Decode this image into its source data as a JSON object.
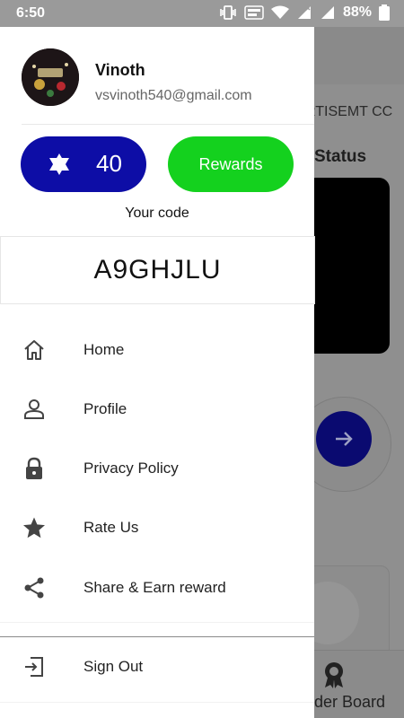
{
  "status_bar": {
    "time": "6:50",
    "battery": "88%"
  },
  "background": {
    "banner_text": "RTISEMT CC",
    "status_heading": "Status",
    "bottom_tab_label": "der Board"
  },
  "drawer": {
    "user": {
      "name": "Vinoth",
      "email": "vsvinoth540@gmail.com"
    },
    "points": {
      "value": "40"
    },
    "rewards_label": "Rewards",
    "code_label": "Your code",
    "code_value": "A9GHJLU",
    "menu": [
      {
        "label": "Home",
        "icon": "home-icon"
      },
      {
        "label": "Profile",
        "icon": "person-icon"
      },
      {
        "label": "Privacy Policy",
        "icon": "lock-icon"
      },
      {
        "label": "Rate Us",
        "icon": "star-icon"
      },
      {
        "label": "Share & Earn reward",
        "icon": "share-icon"
      }
    ],
    "signout_label": "Sign Out"
  },
  "colors": {
    "points_bg": "#0d0da6",
    "rewards_bg": "#14d11e",
    "statusbar_bg": "#9a9a9a"
  }
}
